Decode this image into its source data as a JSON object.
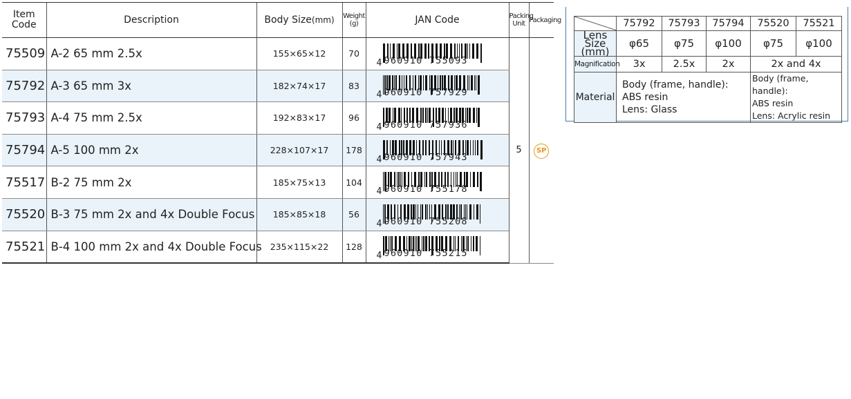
{
  "headers": {
    "item_code": "Item Code",
    "description": "Description",
    "body_size": "Body Size",
    "body_size_unit": "(mm)",
    "weight": "Weight",
    "weight_unit": "(g)",
    "jan_code": "JAN Code",
    "packing_unit": "Packing Unit",
    "packaging": "Packaging"
  },
  "rows": [
    {
      "code": "75509",
      "description": "A-2 65 mm 2.5x",
      "size": "155×65×12",
      "weight": "70",
      "jan_first": "4",
      "jan_rest": "960910 755093"
    },
    {
      "code": "75792",
      "description": "A-3 65 mm 3x",
      "size": "182×74×17",
      "weight": "83",
      "jan_first": "4",
      "jan_rest": "960910 757929"
    },
    {
      "code": "75793",
      "description": "A-4 75 mm 2.5x",
      "size": "192×83×17",
      "weight": "96",
      "jan_first": "4",
      "jan_rest": "960910 757936"
    },
    {
      "code": "75794",
      "description": "A-5 100 mm 2x",
      "size": "228×107×17",
      "weight": "178",
      "jan_first": "4",
      "jan_rest": "960910 757943"
    },
    {
      "code": "75517",
      "description": "B-2 75 mm 2x",
      "size": "185×75×13",
      "weight": "104",
      "jan_first": "4",
      "jan_rest": "960910 755178"
    },
    {
      "code": "75520",
      "description": "B-3 75 mm 2x and 4x Double Focus",
      "size": "185×85×18",
      "weight": "56",
      "jan_first": "4",
      "jan_rest": "960910 755208"
    },
    {
      "code": "75521",
      "description": "B-4 100 mm 2x and 4x Double Focus",
      "size": "235×115×22",
      "weight": "128",
      "jan_first": "4",
      "jan_rest": "960910 755215"
    }
  ],
  "packing_unit_value": "5",
  "packaging_badge": "SP",
  "spec": {
    "columns": [
      "75792",
      "75793",
      "75794",
      "75520",
      "75521"
    ],
    "lens_label": "Lens Size",
    "lens_unit": "(mm)",
    "lens_sizes": [
      "φ65",
      "φ75",
      "φ100",
      "φ75",
      "φ100"
    ],
    "mag_label": "Magnification",
    "magnifications": [
      "3x",
      "2.5x",
      "2x",
      "2x and 4x"
    ],
    "material_label": "Material",
    "material_a": [
      "Body (frame, handle):",
      "ABS resin",
      "Lens: Glass"
    ],
    "material_b": [
      "Body (frame, handle):",
      "ABS resin",
      "Lens: Acrylic resin"
    ]
  },
  "colors": {
    "row_alt": "#eaf3fa",
    "badge": "#e39a1c",
    "spec_border": "#4a7aa8"
  }
}
